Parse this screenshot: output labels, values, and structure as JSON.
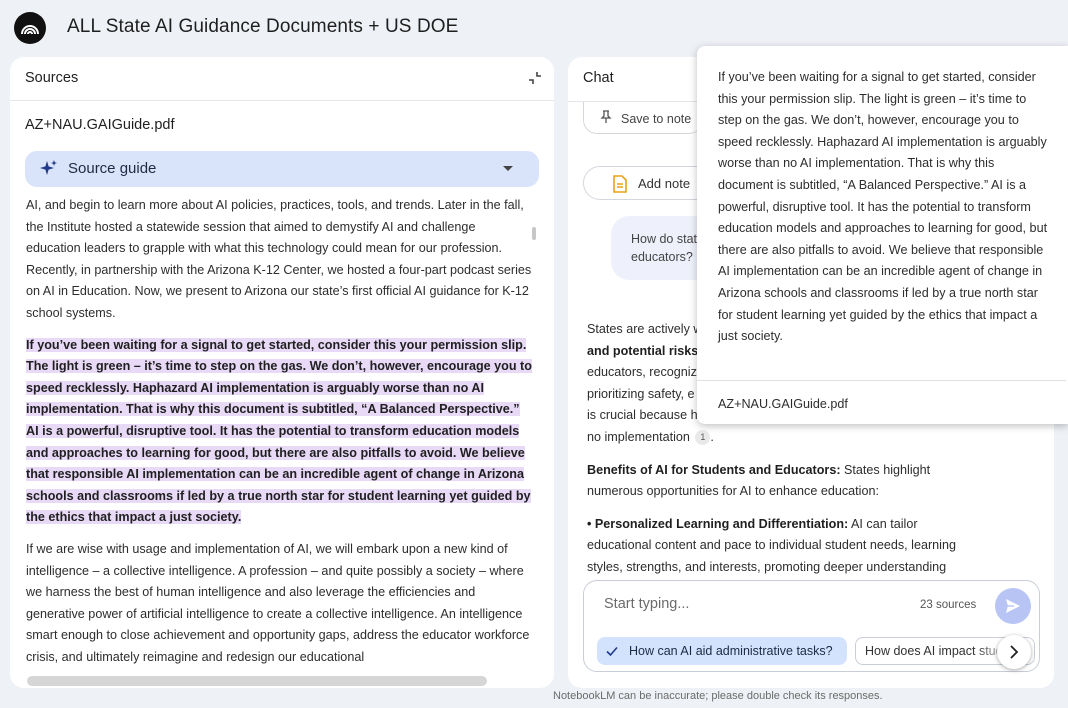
{
  "app": {
    "title": "ALL State AI Guidance Documents + US DOE",
    "logo_icon": "notebooklm-logo"
  },
  "sources": {
    "panel_title": "Sources",
    "collapse_icon": "collapse-icon",
    "document_title": "AZ+NAU.GAIGuide.pdf",
    "source_guide_label": "Source guide",
    "paragraph1": "AI, and begin to learn more about AI policies, practices, tools, and trends. Later in the fall, the Institute hosted a statewide session that aimed to demystify AI and challenge education leaders to grapple with what this technology could mean for our profession. Recently, in partnership with the Arizona K-12 Center, we hosted a four-part podcast series on AI in Education. Now, we present to Arizona our state’s first official AI guidance for K-12 school systems.",
    "highlighted_paragraph": "If you’ve been waiting for a signal to get started, consider this your permission slip. The light is green – it’s time to step on the gas. We don’t, however, encourage you to speed recklessly. Haphazard AI implementation is arguably worse than no AI implementation. That is why this document is subtitled, “A Balanced Perspective.” AI is a powerful, disruptive tool. It has the potential to transform education models and approaches to learning for good, but there are also pitfalls to avoid. We believe that responsible AI implementation can be an incredible agent of change in Arizona schools and classrooms if led by a true north star for student learning yet guided by the ethics that impact a just society.",
    "paragraph3": "If we are wise with usage and implementation of AI, we will embark upon a new kind of intelligence – a collective intelligence. A profession – and quite possibly a society – where we harness the best of human intelligence and also leverage the efficiencies and generative power of artificial intelligence to create a collective intelligence. An intelligence smart enough to close achievement and opportunity gaps, address the educator workforce crisis, and ultimately reimagine and redesign our educational"
  },
  "chat": {
    "panel_title": "Chat",
    "save_to_note_label": "Save to note",
    "add_note_label": "Add note",
    "user_message_line1": "How do stat",
    "user_message_line2": "educators?",
    "response": {
      "p1_start": "States are actively w",
      "p1_bold": "and potential risks",
      "p1_line3": "educators, recogniz",
      "p1_line4": "prioritizing safety, e",
      "p1_line5": "is crucial because h",
      "p1_line6": "no implementation",
      "citation": "1",
      "p2_bold": "Benefits of AI for Students and Educators:",
      "p2_text": " States highlight numerous opportunities for AI to enhance education:",
      "p3_bold": "• Personalized Learning and Differentiation:",
      "p3_text": " AI can tailor educational content and pace to individual student needs, learning styles, strengths, and interests, promoting deeper understanding"
    },
    "input_placeholder": "Start typing...",
    "sources_count": "23 sources",
    "suggestion_1": "How can AI aid administrative tasks?",
    "suggestion_2": "How does AI impact student"
  },
  "popover": {
    "text": "If you’ve been waiting for a signal to get started, consider this your permission slip. The light is green – it’s time to step on the gas. We don’t, however, encourage you to speed recklessly. Haphazard AI implementation is arguably worse than no AI implementation. That is why this document is subtitled, “A Balanced Perspective.” AI is a powerful, disruptive tool. It has the potential to transform education models and approaches to learning for good, but there are also pitfalls to avoid. We believe that responsible AI implementation can be an incredible agent of change in Arizona schools and classrooms if led by a true north star for student learning yet guided by the ethics that impact a just society.",
    "source_name": "AZ+NAU.GAIGuide.pdf"
  },
  "footer": {
    "disclaimer": "NotebookLM can be inaccurate; please double check its responses."
  },
  "colors": {
    "background": "#eef1f6",
    "source_guide_bg": "#d9e3f9",
    "highlight": "#e8d9f7",
    "chip_selected": "#d3e3fd",
    "send_button": "#b7c4f4"
  }
}
